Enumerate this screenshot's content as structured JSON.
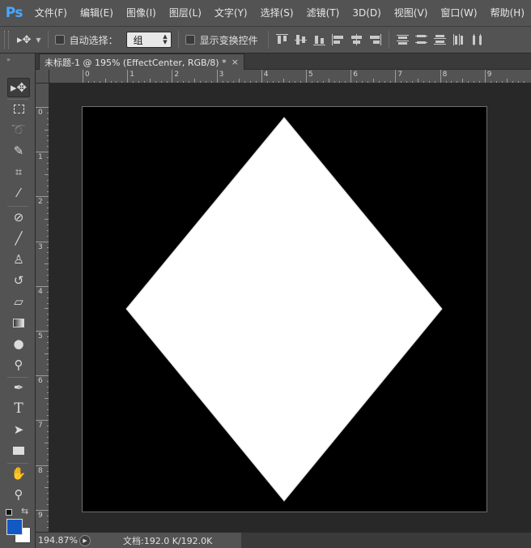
{
  "app": {
    "logo": "Ps"
  },
  "menu": [
    "文件(F)",
    "编辑(E)",
    "图像(I)",
    "图层(L)",
    "文字(Y)",
    "选择(S)",
    "滤镜(T)",
    "3D(D)",
    "视图(V)",
    "窗口(W)",
    "帮助(H)"
  ],
  "options_bar": {
    "auto_select_label": "自动选择：",
    "auto_select_value": "组",
    "show_transform_label": "显示变换控件",
    "auto_select_checked": false,
    "show_transform_checked": false
  },
  "document": {
    "tab_title": "未标题-1 @ 195% (EffectCenter, RGB/8) *",
    "close_glyph": "×",
    "canvas_color": "#000000",
    "shape": {
      "type": "diamond",
      "fill": "#ffffff"
    }
  },
  "rulers": {
    "horizontal_labels": [
      "0",
      "1",
      "2",
      "3",
      "4",
      "5",
      "6",
      "7",
      "8",
      "9"
    ],
    "vertical_labels": [
      "0",
      "1",
      "2",
      "3",
      "4",
      "5",
      "6",
      "7",
      "8",
      "9"
    ]
  },
  "toolbar": {
    "tools": [
      "move-tool",
      "marquee-tool",
      "lasso-tool",
      "quick-selection-tool",
      "crop-tool",
      "eyedropper-tool",
      "healing-brush-tool",
      "brush-tool",
      "clone-stamp-tool",
      "history-brush-tool",
      "eraser-tool",
      "gradient-tool",
      "blur-tool",
      "dodge-tool",
      "pen-tool",
      "type-tool",
      "path-selection-tool",
      "rectangle-tool",
      "hand-tool",
      "zoom-tool"
    ],
    "foreground_color": "#1259c3",
    "background_color": "#ffffff"
  },
  "status": {
    "zoom": "194.87%",
    "doc_info": "文档:192.0 K/192.0K"
  }
}
